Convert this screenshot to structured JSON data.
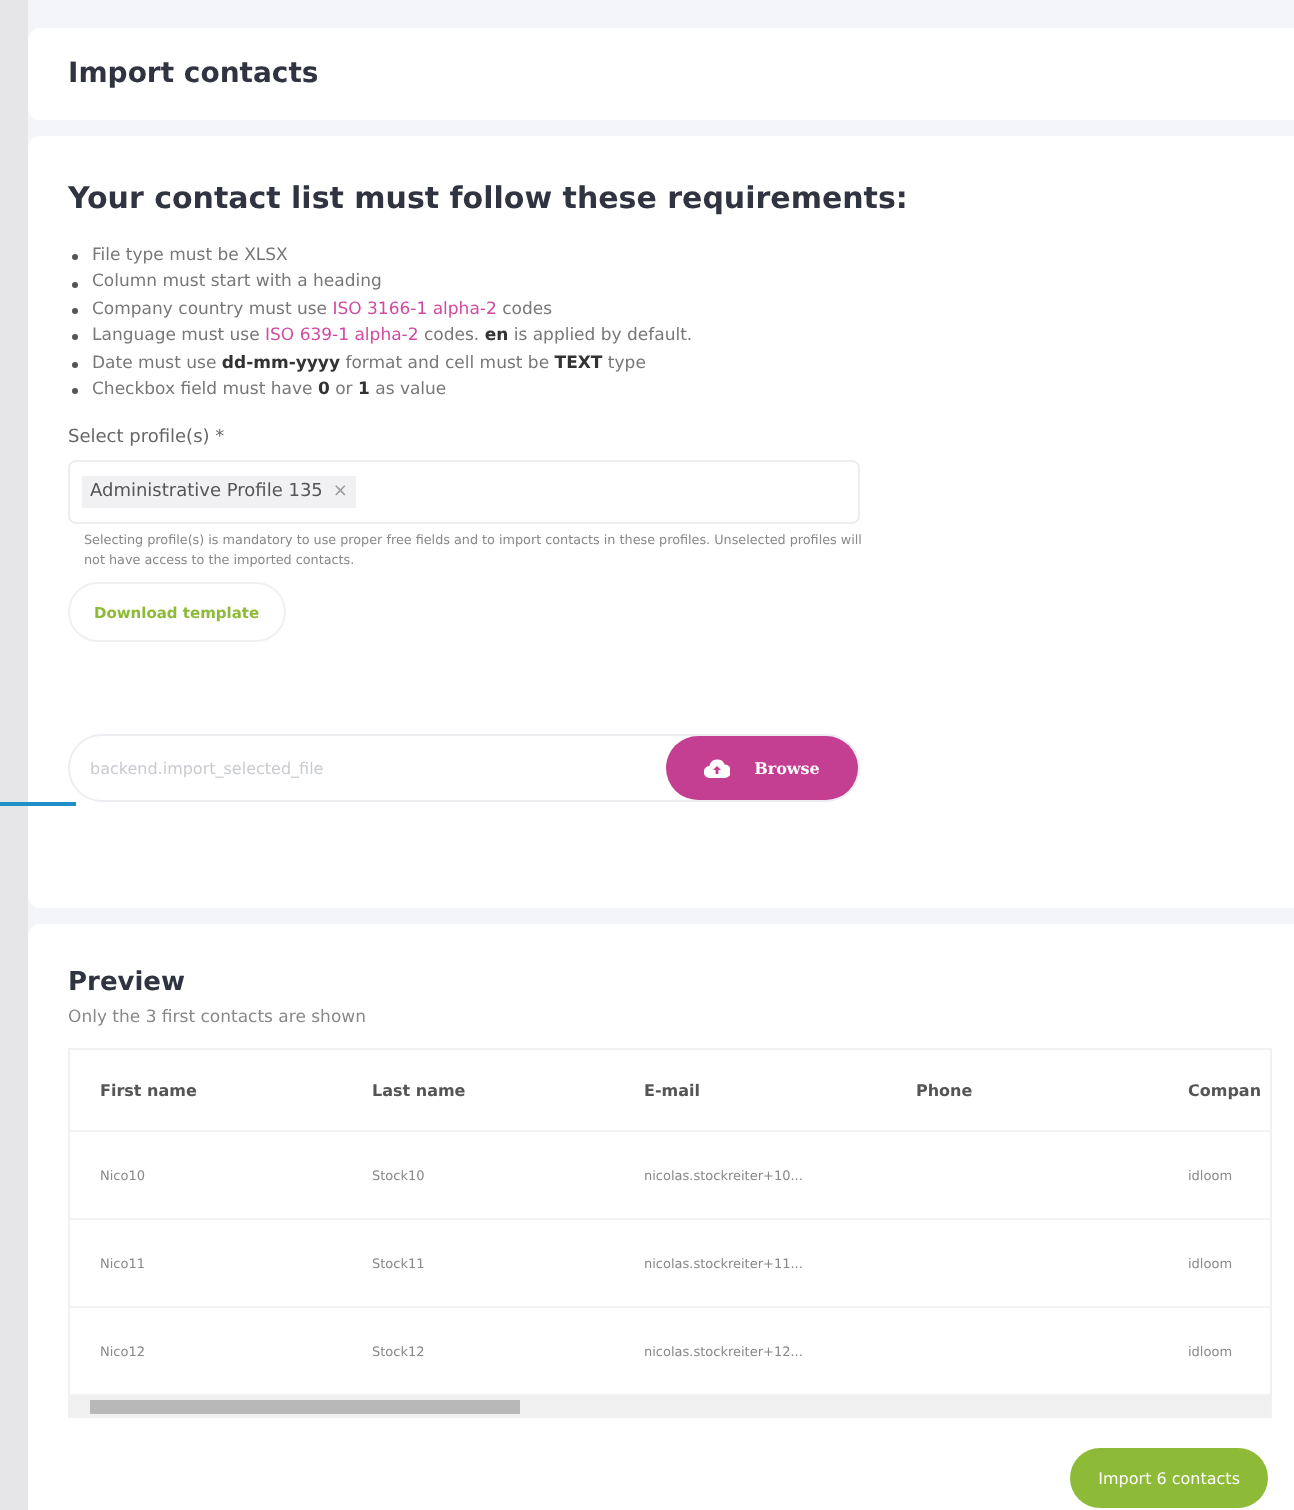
{
  "header": {
    "title": "Import contacts"
  },
  "requirements": {
    "title": "Your contact list must follow these requirements:",
    "items": [
      [
        {
          "kind": "plain",
          "text": "File type must be XLSX"
        }
      ],
      [
        {
          "kind": "plain",
          "text": "Column must start with a heading"
        }
      ],
      [
        {
          "kind": "plain",
          "text": "Company country must use "
        },
        {
          "kind": "link",
          "text": "ISO 3166-1 alpha-2"
        },
        {
          "kind": "plain",
          "text": " codes"
        }
      ],
      [
        {
          "kind": "plain",
          "text": "Language must use "
        },
        {
          "kind": "link",
          "text": "ISO 639-1 alpha-2"
        },
        {
          "kind": "plain",
          "text": " codes. "
        },
        {
          "kind": "bold",
          "text": "en"
        },
        {
          "kind": "plain",
          "text": " is applied by default."
        }
      ],
      [
        {
          "kind": "plain",
          "text": "Date must use "
        },
        {
          "kind": "bold",
          "text": "dd-mm-yyyy"
        },
        {
          "kind": "plain",
          "text": " format and cell must be "
        },
        {
          "kind": "bold",
          "text": "TEXT"
        },
        {
          "kind": "plain",
          "text": " type"
        }
      ],
      [
        {
          "kind": "plain",
          "text": "Checkbox field must have "
        },
        {
          "kind": "bold",
          "text": "0"
        },
        {
          "kind": "plain",
          "text": " or "
        },
        {
          "kind": "bold",
          "text": "1"
        },
        {
          "kind": "plain",
          "text": " as value"
        }
      ]
    ],
    "profiles": {
      "label": "Select profile(s)",
      "required": "*",
      "tags": [
        {
          "text": "Administrative Profile 135",
          "remove": "×"
        }
      ],
      "help": "Selecting profile(s) is mandatory to use proper free fields and to import contacts in these profiles. Unselected profiles will not have access to the imported contacts."
    },
    "template_button": "Download template",
    "file": {
      "placeholder": "backend.import_selected_file",
      "button": "Browse"
    }
  },
  "preview": {
    "title": "Preview",
    "subtitle": "Only the 3 first contacts are shown",
    "table": {
      "columns": [
        "First name",
        "Last name",
        "E-mail",
        "Phone",
        "Compan"
      ],
      "rows": [
        [
          "Nico10",
          "Stock10",
          "nicolas.stockreiter+10...",
          "",
          "idloom"
        ],
        [
          "Nico11",
          "Stock11",
          "nicolas.stockreiter+11...",
          "",
          "idloom"
        ],
        [
          "Nico12",
          "Stock12",
          "nicolas.stockreiter+12...",
          "",
          "idloom"
        ]
      ]
    },
    "import_button": "Import 6 contacts"
  }
}
